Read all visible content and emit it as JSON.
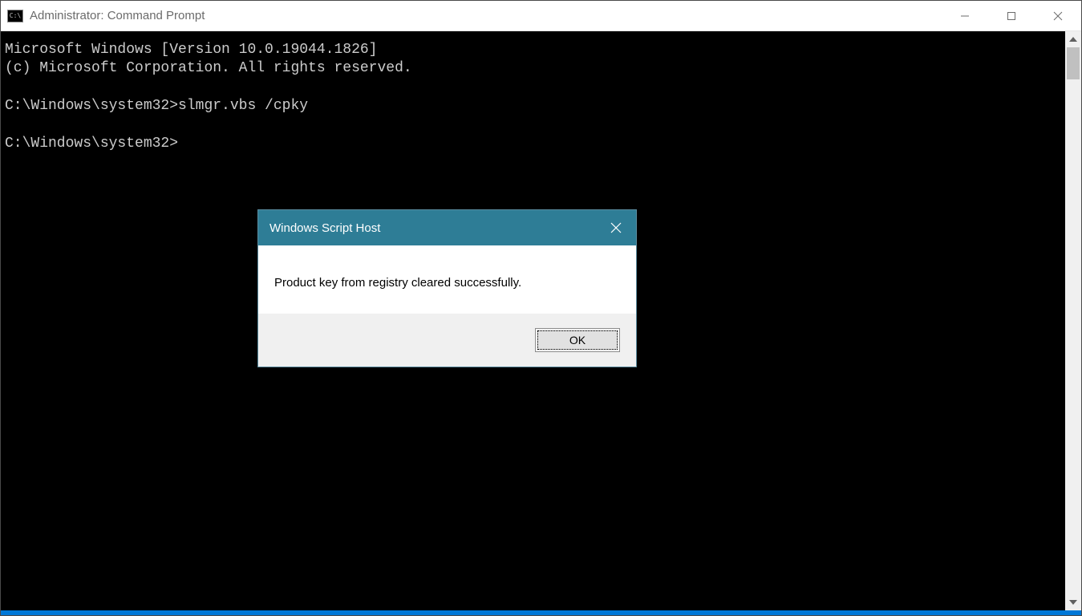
{
  "window": {
    "icon_label": "C:\\",
    "title": "Administrator: Command Prompt"
  },
  "console": {
    "line1": "Microsoft Windows [Version 10.0.19044.1826]",
    "line2": "(c) Microsoft Corporation. All rights reserved.",
    "line3": "",
    "line4": "C:\\Windows\\system32>slmgr.vbs /cpky",
    "line5": "",
    "line6": "C:\\Windows\\system32>"
  },
  "dialog": {
    "title": "Windows Script Host",
    "message": "Product key from registry cleared successfully.",
    "ok_label": "OK"
  }
}
